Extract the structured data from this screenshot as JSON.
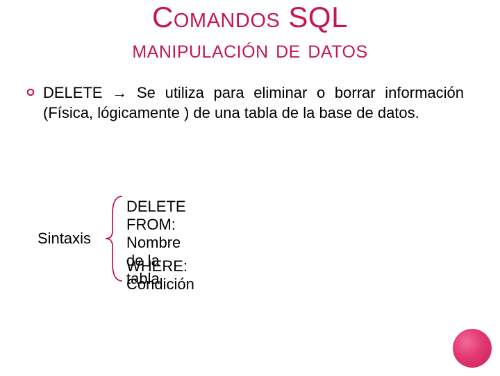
{
  "title": "Comandos SQL",
  "subtitle": "manipulación de datos",
  "bullet": {
    "text": "DELETE → Se utiliza para eliminar o borrar información (Física, lógicamente ) de una tabla de la base de datos."
  },
  "syntax": {
    "label": "Sintaxis",
    "line1": "DELETE FROM: Nombre de la tabla",
    "line2": "WHERE: Condición"
  },
  "colors": {
    "accent": "#c5174e"
  }
}
